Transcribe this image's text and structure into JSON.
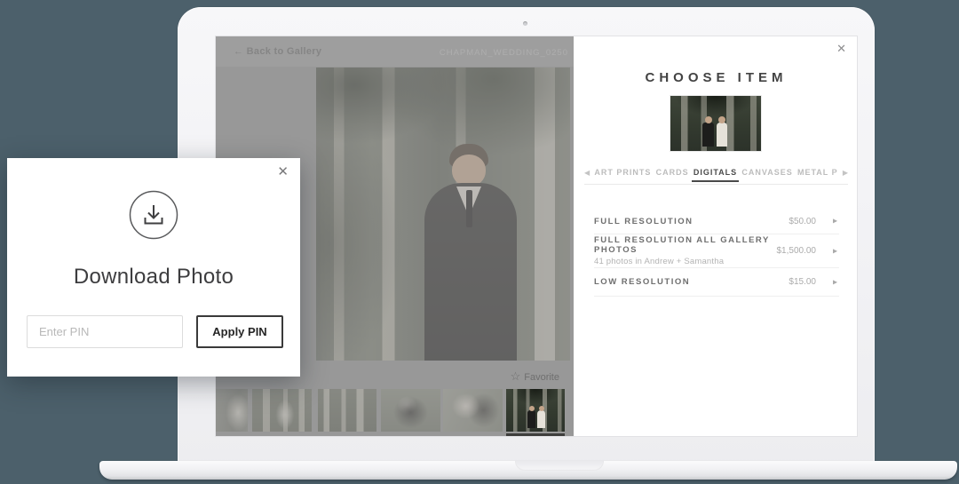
{
  "colors": {
    "page_bg": "#4c606b",
    "active_tab": "#4a4a4a",
    "price_text": "#ababab"
  },
  "gallery": {
    "back_label": "← Back to Gallery",
    "filename": "CHAPMAN_WEDDING_0250",
    "favorite_label": "Favorite"
  },
  "choose_item": {
    "title": "CHOOSE ITEM",
    "active_tab": "DIGITALS",
    "tabs": [
      {
        "label": "ART PRINTS"
      },
      {
        "label": "CARDS"
      },
      {
        "label": "DIGITALS"
      },
      {
        "label": "CANVASES"
      },
      {
        "label": "METAL P"
      }
    ],
    "items": [
      {
        "name": "FULL RESOLUTION",
        "subtitle": "",
        "price": "$50.00"
      },
      {
        "name": "FULL RESOLUTION ALL GALLERY PHOTOS",
        "subtitle": "41 photos in Andrew + Samantha",
        "price": "$1,500.00"
      },
      {
        "name": "LOW RESOLUTION",
        "subtitle": "",
        "price": "$15.00"
      }
    ]
  },
  "download_modal": {
    "title": "Download Photo",
    "pin_placeholder": "Enter PIN",
    "apply_label": "Apply PIN"
  },
  "icons": {
    "close": "✕",
    "star": "☆",
    "tab_left": "◀",
    "tab_right": "▶",
    "chevron": "▸"
  }
}
